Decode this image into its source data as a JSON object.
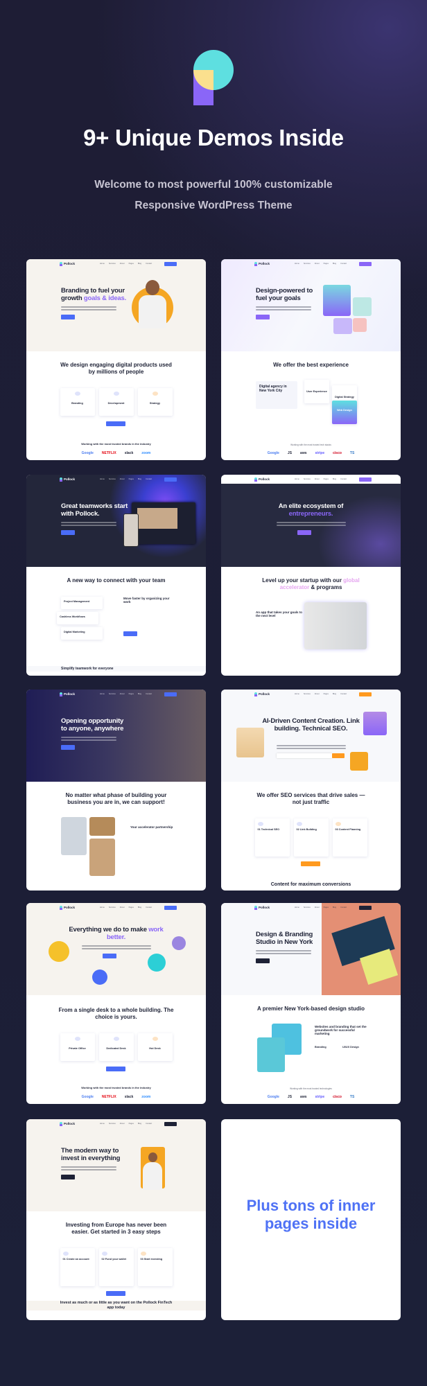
{
  "header": {
    "title": "9+ Unique Demos Inside",
    "subtitle_line1": "Welcome to most powerful 100% customizable",
    "subtitle_line2": "Responsive WordPress Theme"
  },
  "brand": "Pollock",
  "nav_items": [
    "Home",
    "Services",
    "About",
    "Pages",
    "Blog",
    "Contact"
  ],
  "colors": {
    "accent_blue": "#4a6cf7",
    "accent_purple": "#8a66f7",
    "accent_orange": "#ff9a1f",
    "background": "#1e1d35"
  },
  "demos": [
    {
      "headline": "Branding to fuel your growth",
      "headline_accent": "goals & ideas.",
      "section_title": "We design engaging digital products used by millions of people",
      "items": [
        "Branding",
        "Development",
        "Strategy"
      ],
      "logos_label": "Working with the most trusted brands in the industry",
      "logos": [
        "Google",
        "NETFLIX",
        "slack",
        "zoom"
      ]
    },
    {
      "headline": "Design-powered to fuel your goals",
      "headline_accent": "",
      "section_title": "We offer the best experience",
      "items": [
        "Digital agency in New York City",
        "User Experience",
        "Digital Strategy",
        "Web Design"
      ],
      "logos_label": "Working with the most trusted tech stacks",
      "logos": [
        "Google",
        "JS",
        "aws",
        "stripe",
        "cisco",
        "TS"
      ]
    },
    {
      "headline": "Great teamworks start with Pollock.",
      "headline_accent": "",
      "section_title": "A new way to connect with your team",
      "items": [
        "Project Management",
        "Cashless Workflows",
        "Digital Marketing",
        "Move faster by organizing your work"
      ],
      "extra": "Simplify teamwork for everyone",
      "logos": []
    },
    {
      "headline": "An elite ecosystem of",
      "headline_accent": "entrepreneurs.",
      "section_title": "Level up your startup with our",
      "section_accent": "global accelerator",
      "section_tail": "& programs",
      "items": [
        "An app that takes your goals to the next level"
      ],
      "logos": []
    },
    {
      "headline": "Opening opportunity to anyone, anywhere",
      "headline_accent": "",
      "section_title": "No matter what phase of building your business you are in, we can support!",
      "items": [
        "Your accelerator partnership"
      ],
      "logos": []
    },
    {
      "headline": "AI-Driven Content Creation. Link building. Technical SEO.",
      "headline_accent": "",
      "section_title": "We offer SEO services that drive sales — not just traffic",
      "items": [
        "01 Technical SEO",
        "02 Link Building",
        "03 Content Planning"
      ],
      "extra": "Content for maximum conversions",
      "logos": []
    },
    {
      "headline": "Everything we do to make",
      "headline_accent": "work better.",
      "section_title": "From a single desk to a whole building. The choice is yours.",
      "items": [
        "Private Office",
        "Dedicated Desk",
        "Hot Desk"
      ],
      "logos_label": "Working with the most trusted brands in the industry",
      "logos": [
        "Google",
        "NETFLIX",
        "slack",
        "zoom"
      ]
    },
    {
      "headline": "Design & Branding Studio in New York",
      "headline_accent": "",
      "section_title": "A premier New York-based design studio",
      "items": [
        "Websites and branding that set the groundwork for successful marketing",
        "Branding",
        "UI/UX Design"
      ],
      "logos_label": "Working with the most trusted technologies",
      "logos": [
        "Google",
        "JS",
        "aws",
        "stripe",
        "cisco",
        "TS"
      ]
    },
    {
      "headline": "The modern way to invest in everything",
      "headline_accent": "",
      "section_title": "Investing from Europe has never been easier. Get started in 3 easy steps",
      "items": [
        "01 Create an account",
        "02 Fund your wallet",
        "03 Start investing"
      ],
      "extra": "Invest as much or as little as you want on the Pollock FinTech app today",
      "logos": []
    }
  ],
  "inner_pages": "Plus tons of inner pages inside"
}
